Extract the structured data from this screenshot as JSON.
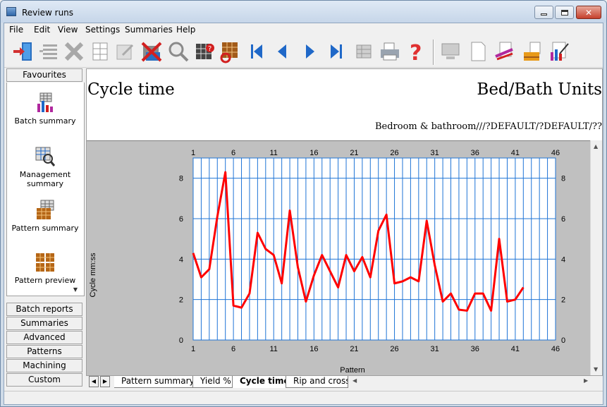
{
  "window": {
    "title": "Review runs"
  },
  "menu": {
    "items": [
      "File",
      "Edit",
      "View",
      "Settings",
      "Summaries",
      "Help"
    ]
  },
  "toolbar": {
    "icons": [
      "exit-icon",
      "list-icon",
      "delete-icon",
      "pattern-grid-icon",
      "edit-grid-icon",
      "cancel-batch-icon",
      "search-icon",
      "grid-help-icon",
      "grid-refresh-icon",
      "first-record-icon",
      "previous-record-icon",
      "next-record-icon",
      "last-record-icon",
      "export-grid-icon",
      "print-icon",
      "help-icon",
      "monitor-icon",
      "blank-page-icon",
      "tools-icon",
      "pallet-icon",
      "chart-edit-icon"
    ]
  },
  "sidebar": {
    "favourites_label": "Favourites",
    "favourites": [
      {
        "label": "Batch summary",
        "icon": "batch-summary-icon"
      },
      {
        "label": "Management summary",
        "icon": "management-summary-icon"
      },
      {
        "label": "Pattern summary",
        "icon": "pattern-summary-icon"
      },
      {
        "label": "Pattern preview",
        "icon": "pattern-preview-icon"
      }
    ],
    "groups": [
      "Batch reports",
      "Summaries",
      "Advanced",
      "Patterns",
      "Machining",
      "Custom"
    ]
  },
  "report": {
    "title": "Cycle time",
    "product": "Bed/Bath Units",
    "description": "Bedroom & bathroom///?DEFAULT/?DEFAULT/??"
  },
  "chart_data": {
    "type": "line",
    "xlabel": "Pattern",
    "ylabel": "Cycle mm:ss",
    "xlim": [
      1,
      46
    ],
    "ylim": [
      0,
      9
    ],
    "x_ticks": [
      1,
      6,
      11,
      16,
      21,
      26,
      31,
      36,
      41,
      46
    ],
    "y_ticks": [
      0,
      2,
      4,
      6,
      8
    ],
    "grid": true,
    "line_color": "#ff0000",
    "grid_color": "#1f74d6",
    "plot_bg": "#ffffff",
    "series": [
      {
        "values": [
          4.3,
          3.1,
          3.5,
          6.1,
          8.3,
          1.7,
          1.6,
          2.3,
          5.3,
          4.5,
          4.2,
          2.8,
          6.4,
          3.6,
          1.9,
          3.2,
          4.2,
          3.4,
          2.6,
          4.2,
          3.4,
          4.1,
          3.1,
          5.4,
          6.2,
          2.8,
          2.9,
          3.1,
          2.9,
          5.9,
          3.7,
          1.9,
          2.3,
          1.5,
          1.45,
          2.3,
          2.3,
          1.45,
          5.0,
          1.9,
          2.0,
          2.6
        ]
      }
    ]
  },
  "tabs": [
    {
      "label": "Pattern summary",
      "active": false
    },
    {
      "label": "Yield %",
      "active": false
    },
    {
      "label": "Cycle time",
      "active": true
    },
    {
      "label": "Rip and crossc",
      "active": false
    }
  ]
}
